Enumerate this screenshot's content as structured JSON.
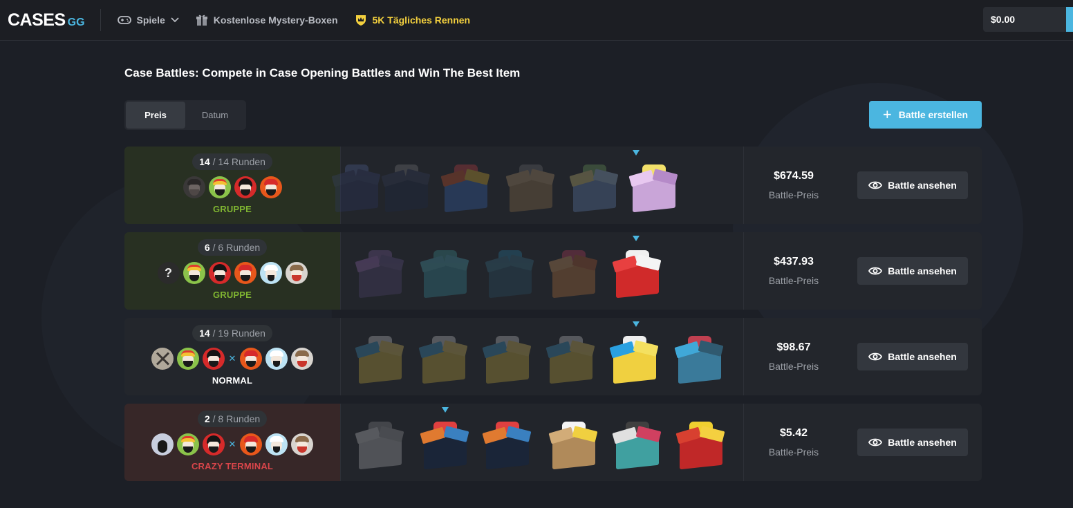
{
  "header": {
    "logo_main": "CASES",
    "logo_gg": "GG",
    "nav": {
      "games": "Spiele",
      "free_boxes": "Kostenlose Mystery-Boxen",
      "race": "5K Tägliches Rennen"
    },
    "balance": "$0.00"
  },
  "page_title": "Case Battles: Compete in Case Opening Battles and Win The Best Item",
  "sort": {
    "price": "Preis",
    "date": "Datum",
    "active": "Preis"
  },
  "create_button": "Battle erstellen",
  "colors": {
    "accent": "#4bb6e0",
    "gold": "#f3d03e",
    "group": "#7fb431",
    "crazy": "#d9454a"
  },
  "battles": [
    {
      "rounds_current": "14",
      "rounds_total": "/ 14 Runden",
      "mode": "GRUPPE",
      "price": "$674.59",
      "price_label": "Battle-Preis",
      "view_label": "Battle ansehen"
    },
    {
      "rounds_current": "6",
      "rounds_total": "/ 6 Runden",
      "mode": "GRUPPE",
      "price": "$437.93",
      "price_label": "Battle-Preis",
      "view_label": "Battle ansehen"
    },
    {
      "rounds_current": "14",
      "rounds_total": "/ 19 Runden",
      "mode": "NORMAL",
      "price": "$98.67",
      "price_label": "Battle-Preis",
      "view_label": "Battle ansehen"
    },
    {
      "rounds_current": "2",
      "rounds_total": "/ 8 Runden",
      "mode": "CRAZY TERMINAL",
      "price": "$5.42",
      "price_label": "Battle-Preis",
      "view_label": "Battle ansehen"
    }
  ]
}
